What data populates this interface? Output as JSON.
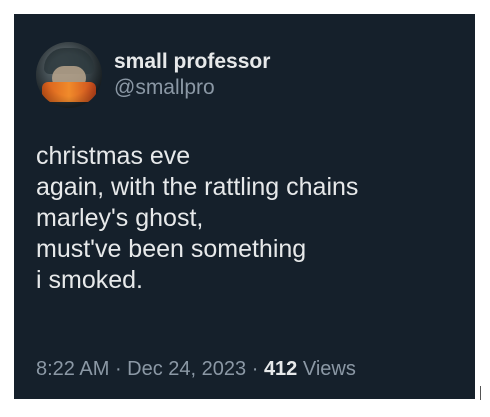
{
  "tweet": {
    "author": {
      "display_name": "small professor",
      "handle": "@smallpro"
    },
    "lines": [
      "christmas eve",
      "again, with the rattling chains",
      "marley's ghost,",
      "must've been something",
      "i smoked."
    ],
    "meta": {
      "time": "8:22 AM",
      "separator": " · ",
      "date": "Dec 24, 2023",
      "separator2": " · ",
      "views_count": "412",
      "views_label": " Views"
    }
  },
  "colors": {
    "background": "#15202b",
    "primary_text": "#e7e9ea",
    "secondary_text": "#8b98a5"
  }
}
